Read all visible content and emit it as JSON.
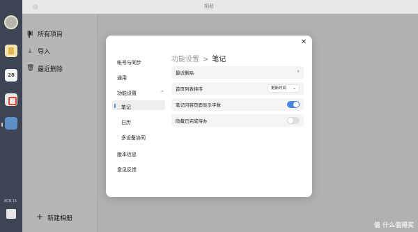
{
  "window": {
    "title": "相册"
  },
  "dock": {
    "calendar_day": "28",
    "battery_text": "ECB 15"
  },
  "sidebar": {
    "items": [
      {
        "label": "所有项目",
        "icon": "photo-icon",
        "glyph": "▣"
      },
      {
        "label": "导入",
        "icon": "download-icon",
        "glyph": "⤓"
      },
      {
        "label": "最近删除",
        "icon": "trash-icon",
        "glyph": "🗑"
      }
    ],
    "new_album": {
      "label": "新建相册",
      "glyph": "+"
    }
  },
  "modal": {
    "close_glyph": "✕",
    "nav": {
      "items": [
        {
          "label": "帐号与同步"
        },
        {
          "label": "通用"
        },
        {
          "label": "功能设置",
          "expanded": true
        },
        {
          "label": "笔记",
          "selected": true
        },
        {
          "label": "日历"
        },
        {
          "label": "多设备协同"
        },
        {
          "label": "版本信息"
        },
        {
          "label": "意见反馈"
        }
      ],
      "chevron": "⌃"
    },
    "breadcrumb": {
      "parent": "功能设置",
      "separator": ">",
      "current": "笔记"
    },
    "rows": [
      {
        "label": "最近删除",
        "control": "chevron",
        "glyph": "›"
      },
      {
        "label": "首页列表排序",
        "control": "select",
        "value": "更新时间",
        "caret": "⌄"
      },
      {
        "label": "笔记内容页面显示字数",
        "control": "toggle",
        "on": true
      },
      {
        "label": "隐藏已完成待办",
        "control": "toggle",
        "on": false
      }
    ],
    "accent_color": "#4a86e0"
  },
  "watermark": "值 什么值得买"
}
